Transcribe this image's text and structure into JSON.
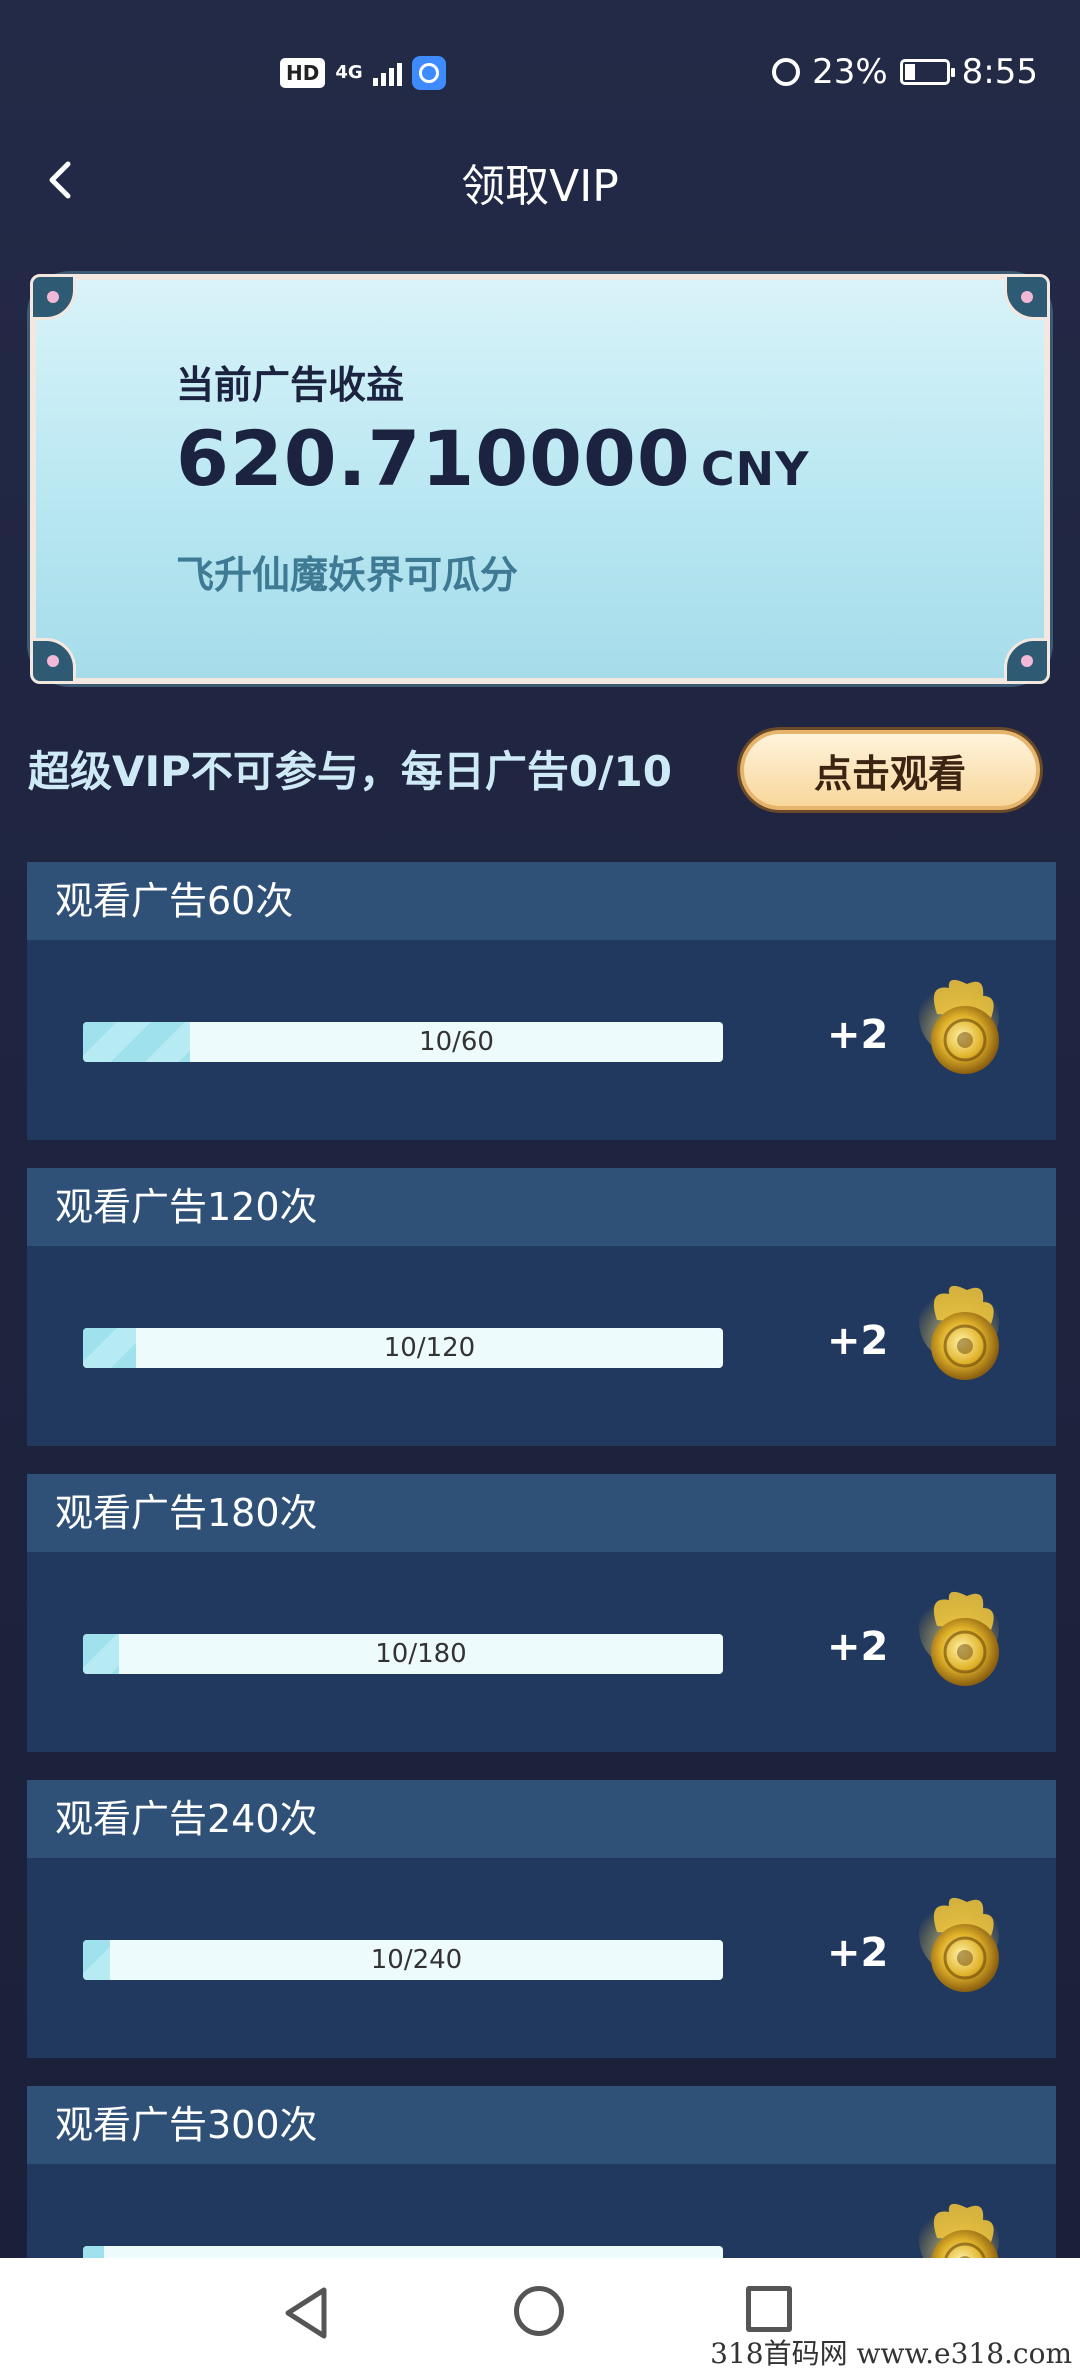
{
  "status_bar": {
    "hd": "HD",
    "network": "4G",
    "battery_percent": "23%",
    "time": "8:55",
    "icons": [
      "signal-icon",
      "app-notification-icon",
      "alarm-icon",
      "battery-icon"
    ]
  },
  "header": {
    "title": "领取VIP",
    "back_icon": "chevron-left-icon"
  },
  "revenue_card": {
    "label": "当前广告收益",
    "amount": "620.710000",
    "unit": "CNY",
    "note": "飞升仙魔妖界可瓜分"
  },
  "daily": {
    "text": "超级VIP不可参与，每日广告0/10",
    "button_label": "点击观看"
  },
  "tasks": [
    {
      "title": "观看广告60次",
      "progress_text": "10/60",
      "progress_fraction": 0.1667,
      "reward": "+2",
      "reward_icon": "gold-orb-icon"
    },
    {
      "title": "观看广告120次",
      "progress_text": "10/120",
      "progress_fraction": 0.0833,
      "reward": "+2",
      "reward_icon": "gold-orb-icon"
    },
    {
      "title": "观看广告180次",
      "progress_text": "10/180",
      "progress_fraction": 0.0556,
      "reward": "+2",
      "reward_icon": "gold-orb-icon"
    },
    {
      "title": "观看广告240次",
      "progress_text": "10/240",
      "progress_fraction": 0.0417,
      "reward": "+2",
      "reward_icon": "gold-orb-icon"
    },
    {
      "title": "观看广告300次",
      "progress_text": "",
      "progress_fraction": 0.0333,
      "reward": "",
      "reward_icon": "gold-orb-icon"
    }
  ],
  "nav_bar": {
    "icons": [
      "back-triangle-icon",
      "home-circle-icon",
      "recent-apps-square-icon"
    ]
  },
  "watermark": "318首码网  www.e318.com"
}
